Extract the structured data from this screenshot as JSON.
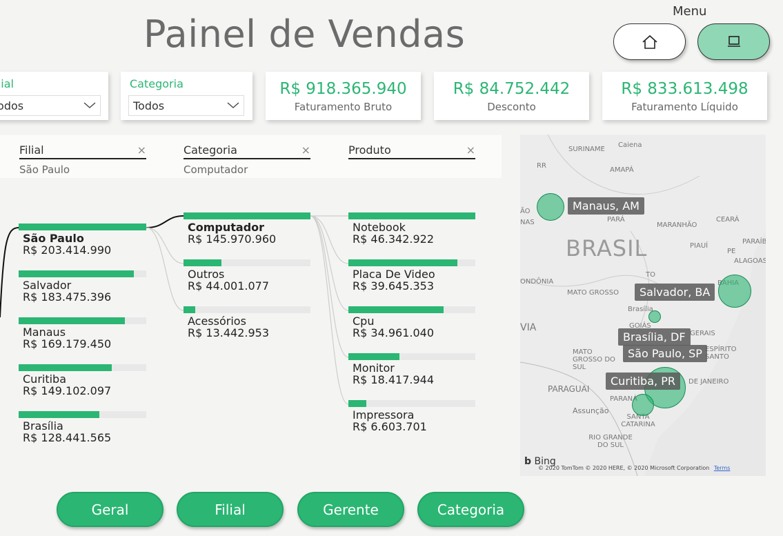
{
  "header": {
    "title": "Painel de Vendas",
    "menu_label": "Menu",
    "home_icon": "home-icon",
    "computer_icon": "computer-icon"
  },
  "slicers": [
    {
      "title": "Filial",
      "value": "Todos"
    },
    {
      "title": "Categoria",
      "value": "Todos"
    }
  ],
  "kpis": [
    {
      "value": "R$ 918.365.940",
      "label": "Faturamento Bruto"
    },
    {
      "value": "R$ 84.752.442",
      "label": "Desconto"
    },
    {
      "value": "R$ 833.613.498",
      "label": "Faturamento Líquido"
    }
  ],
  "breadcrumbs": [
    {
      "label": "Filial",
      "value": "São Paulo"
    },
    {
      "label": "Categoria",
      "value": "Computador"
    },
    {
      "label": "Produto",
      "value": ""
    }
  ],
  "tree": {
    "filial": [
      {
        "name": "São Paulo",
        "value": "R$ 203.414.990",
        "pct": 1.0,
        "selected": true
      },
      {
        "name": "Salvador",
        "value": "R$ 183.475.396",
        "pct": 0.9
      },
      {
        "name": "Manaus",
        "value": "R$ 169.179.450",
        "pct": 0.83
      },
      {
        "name": "Curitiba",
        "value": "R$ 149.102.097",
        "pct": 0.73
      },
      {
        "name": "Brasília",
        "value": "R$ 128.441.565",
        "pct": 0.63
      }
    ],
    "categoria": [
      {
        "name": "Computador",
        "value": "R$ 145.970.960",
        "pct": 1.0,
        "selected": true
      },
      {
        "name": "Outros",
        "value": "R$ 44.001.077",
        "pct": 0.3
      },
      {
        "name": "Acessórios",
        "value": "R$ 13.442.953",
        "pct": 0.09
      }
    ],
    "produto": [
      {
        "name": "Notebook",
        "value": "R$ 46.342.922",
        "pct": 1.0
      },
      {
        "name": "Placa De Video",
        "value": "R$ 39.645.353",
        "pct": 0.86
      },
      {
        "name": "Cpu",
        "value": "R$ 34.961.040",
        "pct": 0.75
      },
      {
        "name": "Monitor",
        "value": "R$ 18.417.944",
        "pct": 0.4
      },
      {
        "name": "Impressora",
        "value": "R$ 6.603.701",
        "pct": 0.14
      }
    ]
  },
  "map": {
    "country_label": "BRASIL",
    "cities": [
      {
        "label": "Manaus, AM"
      },
      {
        "label": "Salvador, BA"
      },
      {
        "label": "Brasília, DF"
      },
      {
        "label": "São Paulo, SP"
      },
      {
        "label": "Curitiba, PR"
      }
    ],
    "places": [
      "SURINAME",
      "Caiena",
      "AMAPÁ",
      "RR",
      "PARÁ",
      "MARANHÃO",
      "CEARÁ",
      "PIAUÍ",
      "PARAÍB",
      "ALAGOAS",
      "PE",
      "BAHIA",
      "TO",
      "ONDÔNIA",
      "MATO GROSSO",
      "Brasília",
      "GOIÁS",
      "GERAIS",
      "VIA",
      "MATO GROSSO DO SUL",
      "ESPÍRITO SANTO",
      "PARAGUAI",
      "PARANÁ",
      "DE JANEIRO",
      "Assunção",
      "SANTA CATARINA",
      "RIO GRANDE DO SUL",
      "NAS",
      "ÃO"
    ],
    "bing_label": "Bing",
    "copyright": "© 2020 TomTom © 2020 HERE, © 2020 Microsoft Corporation",
    "terms": "Terms"
  },
  "nav_buttons": [
    "Geral",
    "Filial",
    "Gerente",
    "Categoria"
  ],
  "colors": {
    "accent": "#2bb673",
    "accent_light": "#8fd7b5"
  }
}
